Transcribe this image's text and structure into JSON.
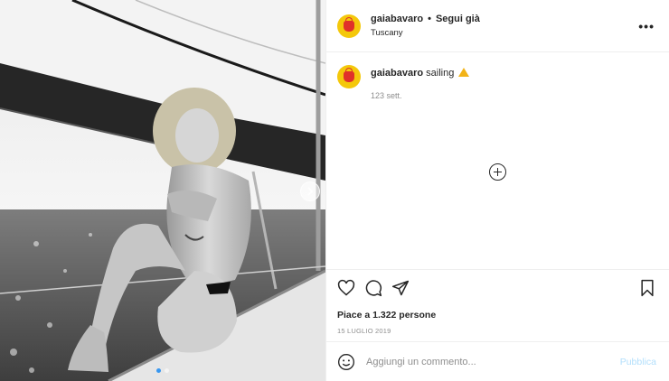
{
  "header": {
    "username": "gaiabavaro",
    "separator": "•",
    "follow_label": "Segui già",
    "location": "Tuscany",
    "more_label": "•••"
  },
  "caption": {
    "username": "gaiabavaro",
    "text": "sailing",
    "emoji_icon": "warning-sign-icon",
    "time_ago": "123 sett."
  },
  "actions": {
    "likes_text": "Piace a 1.322 persone",
    "date": "15 LUGLIO 2019"
  },
  "comment_box": {
    "placeholder": "Aggiungi un commento...",
    "publish_label": "Pubblica"
  },
  "colors": {
    "avatar_bg": "#f4c80b",
    "avatar_icon": "#e0312a",
    "publish_disabled": "#b2dffc",
    "active_dot": "#3897f0"
  },
  "carousel": {
    "slide_count": 2,
    "active_index": 0
  }
}
